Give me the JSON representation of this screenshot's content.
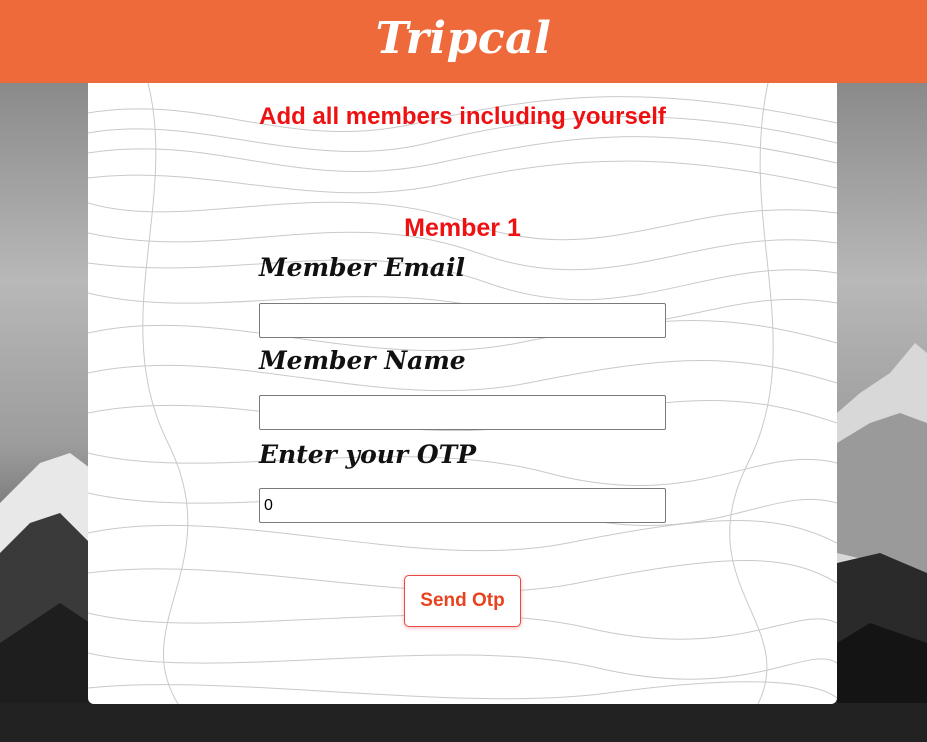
{
  "header": {
    "brand": "Tripcal"
  },
  "card": {
    "heading": "Add all members including yourself",
    "member_title": "Member 1",
    "fields": [
      {
        "label": "Member Email",
        "value": ""
      },
      {
        "label": "Member Name",
        "value": ""
      },
      {
        "label": "Enter your OTP",
        "value": "0"
      }
    ],
    "send_button": "Send Otp"
  },
  "colors": {
    "header_bg": "#ee6a3b",
    "heading_red": "#ee1111",
    "button_text": "#e8431f"
  }
}
